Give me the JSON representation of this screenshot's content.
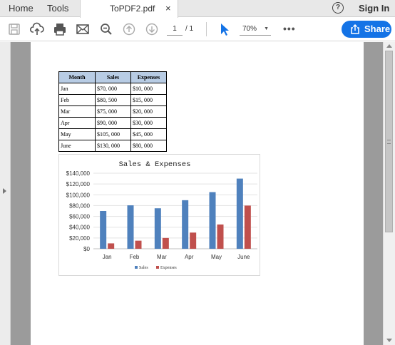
{
  "tabs": {
    "home": "Home",
    "tools": "Tools",
    "document": "ToPDF2.pdf",
    "close_glyph": "×"
  },
  "header": {
    "help_glyph": "?",
    "sign_in": "Sign In"
  },
  "toolbar": {
    "icons": [
      "save-icon",
      "upload-cloud-icon",
      "print-icon",
      "email-icon",
      "zoom-out-icon",
      "page-up-icon",
      "page-down-icon",
      "select-cursor-icon"
    ],
    "page_current": "1",
    "page_total": "/ 1",
    "zoom": "70%",
    "zoom_caret": "▼",
    "more": "•••",
    "share": "Share"
  },
  "colors": {
    "accent": "#1473e6",
    "sales": "#4f81bd",
    "expenses": "#c0504d",
    "table_header": "#b8cce4"
  },
  "table": {
    "headers": [
      "Month",
      "Sales",
      "Expenses"
    ],
    "rows": [
      [
        "Jan",
        "$70, 000",
        "$10, 000"
      ],
      [
        "Feb",
        "$80, 500",
        "$15, 000"
      ],
      [
        "Mar",
        "$75, 000",
        "$20, 000"
      ],
      [
        "Apr",
        "$90, 000",
        "$30, 000"
      ],
      [
        "May",
        "$105, 000",
        "$45, 000"
      ],
      [
        "June",
        "$130, 000",
        "$80, 000"
      ]
    ]
  },
  "chart_data": {
    "type": "bar",
    "title": "Sales & Expenses",
    "categories": [
      "Jan",
      "Feb",
      "Mar",
      "Apr",
      "May",
      "June"
    ],
    "series": [
      {
        "name": "Sales",
        "color": "#4f81bd",
        "values": [
          70000,
          80500,
          75000,
          90000,
          105000,
          130000
        ]
      },
      {
        "name": "Expenses",
        "color": "#c0504d",
        "values": [
          10000,
          15000,
          20000,
          30000,
          45000,
          80000
        ]
      }
    ],
    "ylim": [
      0,
      140000
    ],
    "yticks": [
      "$0",
      "$20,000",
      "$40,000",
      "$60,000",
      "$80,000",
      "$100,000",
      "$120,000",
      "$140,000"
    ],
    "grid": true,
    "legend": "bottom"
  }
}
